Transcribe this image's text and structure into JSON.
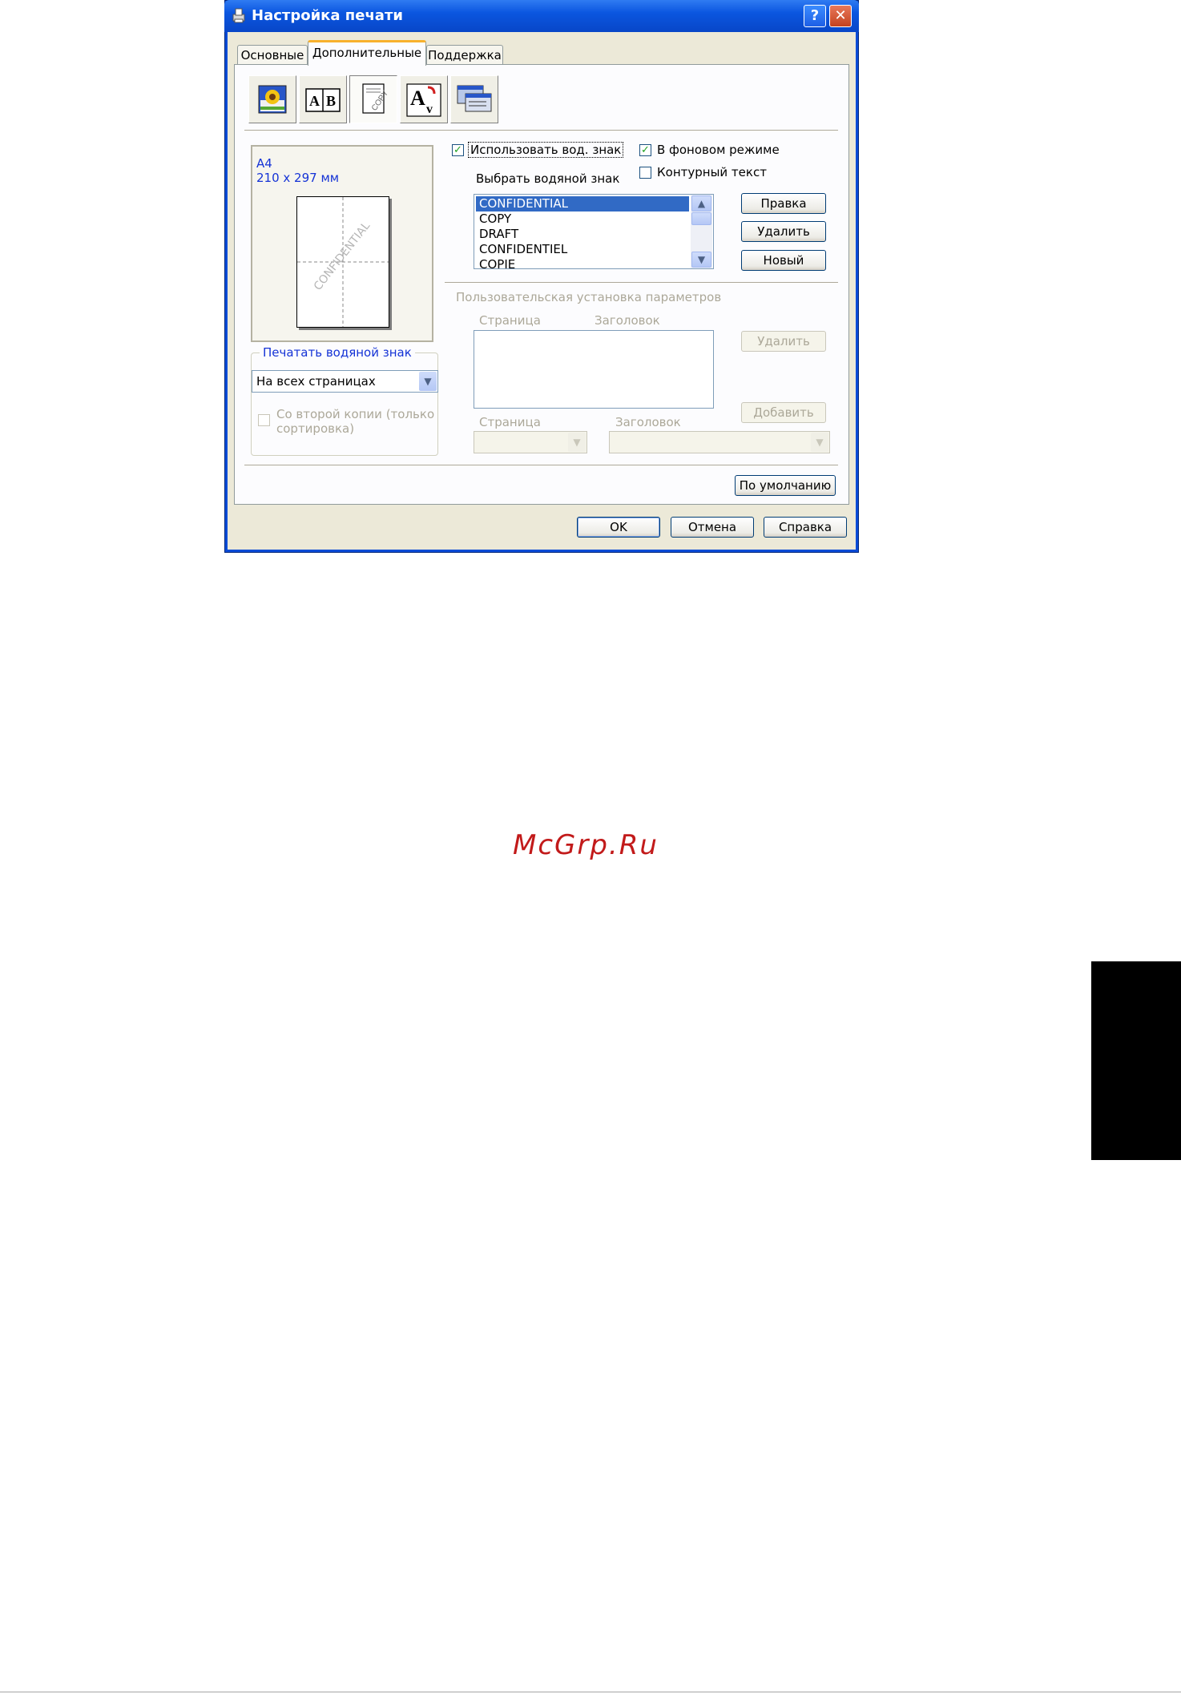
{
  "window": {
    "title": "Настройка печати",
    "help_glyph": "?",
    "close_glyph": "✕"
  },
  "tabs": [
    {
      "label": "Основные"
    },
    {
      "label": "Дополнительные"
    },
    {
      "label": "Поддержка"
    }
  ],
  "toolbar": {
    "icons": [
      "print-quality-icon",
      "duplex-ab-icon",
      "watermark-copy-icon",
      "text-scaling-icon",
      "device-options-icon"
    ],
    "active_index": 2
  },
  "preview": {
    "paper_name": "A4",
    "paper_size": "210 x 297 мм",
    "watermark_text": "CONFIDENTIAL"
  },
  "print_watermark": {
    "group_title": "Печатать водяной знак",
    "selected": "На всех страницах",
    "second_copy_label_line1": "Со второй копии (только",
    "second_copy_label_line2": "сортировка)",
    "second_copy_checked": false
  },
  "use_watermark": {
    "label": "Использовать вод. знак",
    "checked": true
  },
  "background_mode": {
    "label": "В фоновом режиме",
    "checked": true
  },
  "outline_text": {
    "label": "Контурный текст",
    "checked": false
  },
  "select_watermark": {
    "label": "Выбрать водяной знак",
    "items": [
      "CONFIDENTIAL",
      "COPY",
      "DRAFT",
      "CONFIDENTIEL",
      "COPIE"
    ],
    "selected_index": 0
  },
  "buttons": {
    "edit": "Правка",
    "delete": "Удалить",
    "new": "Новый",
    "custom_delete": "Удалить",
    "custom_add": "Добавить",
    "default": "По умолчанию",
    "ok": "OK",
    "cancel": "Отмена",
    "help": "Справка"
  },
  "custom_settings": {
    "title": "Пользовательская установка параметров",
    "col_page": "Страница",
    "col_title": "Заголовок",
    "page_label": "Страница",
    "title_label": "Заголовок"
  },
  "brand": "McGrp.Ru",
  "colors": {
    "titlebar": "#0b56e0",
    "dialog_bg": "#ece9d8",
    "selection": "#316ac5",
    "brand": "#c21a1a"
  }
}
